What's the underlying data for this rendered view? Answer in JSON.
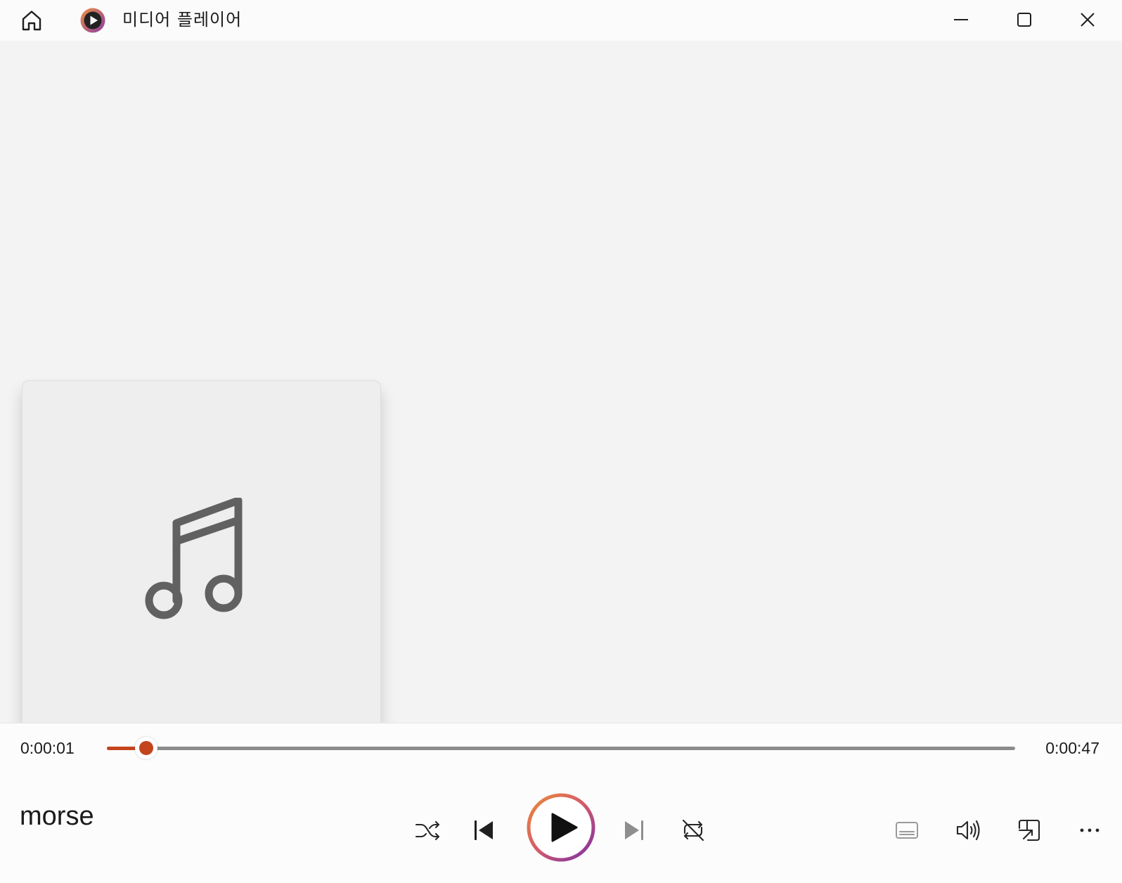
{
  "titlebar": {
    "app_title": "미디어 플레이어",
    "icons": [
      "home-icon",
      "media-player-logo-icon",
      "minimize-icon",
      "maximize-icon",
      "close-icon"
    ]
  },
  "album_art": {
    "icon": "music-note-icon"
  },
  "playback": {
    "elapsed": "0:00:01",
    "total": "0:00:47",
    "progress": 0.043,
    "track_title": "morse"
  },
  "controls": {
    "icons": [
      "shuffle-icon",
      "previous-icon",
      "play-icon",
      "next-icon",
      "repeat-icon",
      "captions-icon",
      "volume-icon",
      "mini-player-icon",
      "more-options-icon"
    ]
  },
  "colors": {
    "accent": "#c4441e",
    "ring_start": "#e8863a",
    "ring_end": "#7a2fa6",
    "titlebar_bg": "#fbfbfb",
    "content_bg": "#f3f3f3",
    "panel_bg": "#fcfcfc"
  }
}
